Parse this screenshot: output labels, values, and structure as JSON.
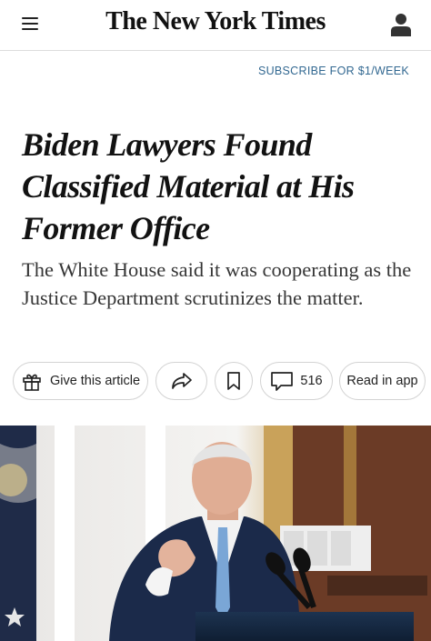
{
  "header": {
    "logo_text": "The New York Times",
    "menu_icon": "hamburger-menu-icon",
    "account_icon": "user-account-icon"
  },
  "subscribe": {
    "label": "SUBSCRIBE FOR $1/WEEK",
    "color": "#326891"
  },
  "article": {
    "headline": "Biden Lawyers Found Classified Material at His Former Office",
    "summary": "The White House said it was cooperating as the Justice Department scrutinizes the matter."
  },
  "actions": {
    "gift_label": "Give this article",
    "gift_icon": "gift-icon",
    "share_icon": "share-arrow-icon",
    "save_icon": "bookmark-icon",
    "comment_icon": "comment-bubble-icon",
    "comment_count": "516",
    "read_in_app_label": "Read in app"
  },
  "photo": {
    "description_icon": "lead-photo"
  }
}
